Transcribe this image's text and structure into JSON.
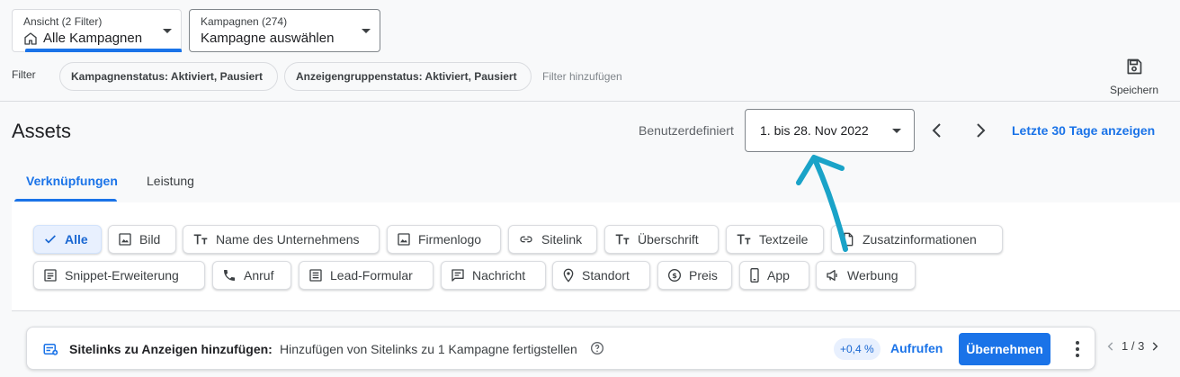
{
  "view_selector": {
    "label": "Ansicht (2 Filter)",
    "value": "Alle Kampagnen",
    "icon": "home-icon"
  },
  "campaign_selector": {
    "label": "Kampagnen (274)",
    "value": "Kampagne auswählen"
  },
  "filter": {
    "label": "Filter",
    "chips": [
      "Kampagnenstatus: Aktiviert, Pausiert",
      "Anzeigengruppenstatus: Aktiviert, Pausiert"
    ],
    "add_label": "Filter hinzufügen"
  },
  "save": {
    "label": "Speichern",
    "icon": "save-icon"
  },
  "header": {
    "title": "Assets",
    "range_label": "Benutzerdefiniert",
    "date_range": "1. bis 28. Nov 2022",
    "last30_link": "Letzte 30 Tage anzeigen"
  },
  "tabs": [
    {
      "label": "Verknüpfungen",
      "active": true
    },
    {
      "label": "Leistung",
      "active": false
    }
  ],
  "asset_types": {
    "row1": [
      {
        "label": "Alle",
        "icon": "check-icon",
        "selected": true
      },
      {
        "label": "Bild",
        "icon": "image-icon"
      },
      {
        "label": "Name des Unternehmens",
        "icon": "text-format-icon"
      },
      {
        "label": "Firmenlogo",
        "icon": "image-icon"
      },
      {
        "label": "Sitelink",
        "icon": "link-icon"
      },
      {
        "label": "Überschrift",
        "icon": "text-format-icon"
      },
      {
        "label": "Textzeile",
        "icon": "text-format-icon"
      },
      {
        "label": "Zusatzinformationen",
        "icon": "document-icon"
      }
    ],
    "row2": [
      {
        "label": "Snippet-Erweiterung",
        "icon": "list-icon"
      },
      {
        "label": "Anruf",
        "icon": "phone-icon"
      },
      {
        "label": "Lead-Formular",
        "icon": "form-icon"
      },
      {
        "label": "Nachricht",
        "icon": "message-icon"
      },
      {
        "label": "Standort",
        "icon": "location-icon"
      },
      {
        "label": "Preis",
        "icon": "dollar-icon"
      },
      {
        "label": "App",
        "icon": "phone-device-icon"
      },
      {
        "label": "Werbung",
        "icon": "megaphone-icon"
      }
    ]
  },
  "recommendation": {
    "title": "Sitelinks zu Anzeigen hinzufügen:",
    "description": "Hinzufügen von Sitelinks zu 1 Kampagne fertigstellen",
    "badge": "+0,4 %",
    "open_label": "Aufrufen",
    "apply_label": "Übernehmen"
  },
  "pager": {
    "text": "1 / 3"
  },
  "colors": {
    "accent": "#1a73e8",
    "annotation": "#1aa3c8"
  }
}
